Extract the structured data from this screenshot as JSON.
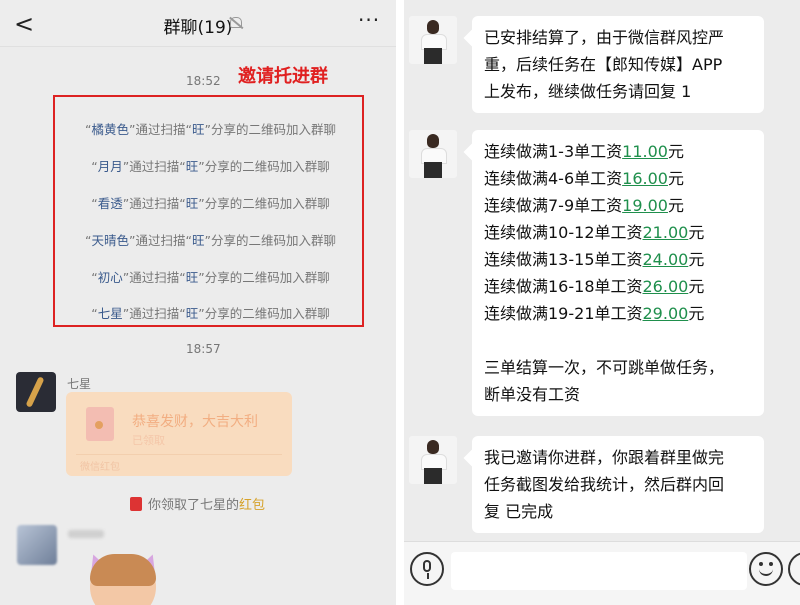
{
  "left": {
    "header": {
      "back": "<",
      "title": "群聊(19)",
      "more": "···"
    },
    "time1": "18:52",
    "annotation": "邀请托进群",
    "system_messages": [
      {
        "name": "橘黄色",
        "pre": "通过扫描",
        "source": "旺",
        "post": "分享的二维码加入群聊"
      },
      {
        "name": "月月",
        "pre": "通过扫描",
        "source": "旺",
        "post": "分享的二维码加入群聊"
      },
      {
        "name": "看透",
        "pre": "通过扫描",
        "source": "旺",
        "post": "分享的二维码加入群聊"
      },
      {
        "name": "天晴色",
        "pre": "通过扫描",
        "source": "旺",
        "post": "分享的二维码加入群聊"
      },
      {
        "name": "初心",
        "pre": "通过扫描",
        "source": "旺",
        "post": "分享的二维码加入群聊"
      },
      {
        "name": "七星",
        "pre": "通过扫描",
        "source": "旺",
        "post": "分享的二维码加入群聊"
      }
    ],
    "time2": "18:57",
    "sender": "七星",
    "hongbao": {
      "title": "恭喜发财，大吉大利",
      "status": "已领取",
      "footer": "微信红包"
    },
    "notice": {
      "pre": "你领取了七星的",
      "highlight": "红包"
    }
  },
  "right": {
    "messages": [
      {
        "lines": [
          "已安排结算了，由于微信群风控严",
          "重，后续任务在【郎知传媒】APP",
          "上发布，继续做任务请回复 1"
        ]
      },
      {
        "rows": [
          {
            "text": "连续做满1-3单工资",
            "amount": "11.00",
            "unit": "元"
          },
          {
            "text": "连续做满4-6单工资",
            "amount": "16.00",
            "unit": "元"
          },
          {
            "text": "连续做满7-9单工资",
            "amount": "19.00",
            "unit": "元"
          },
          {
            "text": "连续做满10-12单工资",
            "amount": "21.00",
            "unit": "元"
          },
          {
            "text": "连续做满13-15单工资",
            "amount": "24.00",
            "unit": "元"
          },
          {
            "text": "连续做满16-18单工资",
            "amount": "26.00",
            "unit": "元"
          },
          {
            "text": "连续做满19-21单工资",
            "amount": "29.00",
            "unit": "元"
          }
        ],
        "tail": [
          "三单结算一次，不可跳单做任务，",
          "断单没有工资"
        ]
      },
      {
        "lines": [
          "我已邀请你进群，你跟着群里做完",
          "任务截图发给我统计，然后群内回",
          "复 已完成"
        ]
      }
    ]
  }
}
